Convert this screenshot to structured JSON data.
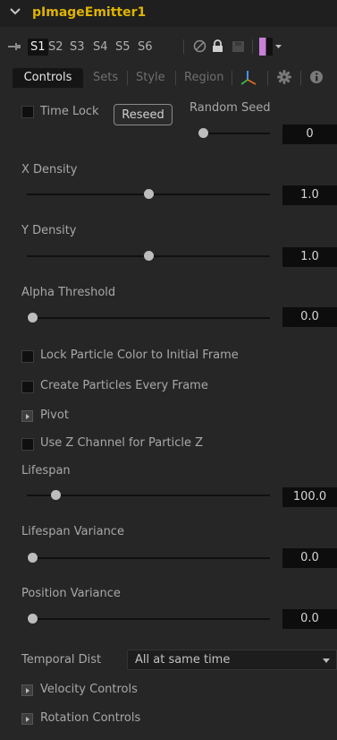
{
  "tool": {
    "name": "pImageEmitter1"
  },
  "slots": [
    "S1",
    "S2",
    "S3",
    "S4",
    "S5",
    "S6"
  ],
  "tabs": {
    "controls": "Controls",
    "sets": "Sets",
    "style": "Style",
    "region": "Region"
  },
  "icons": [
    "pin-icon",
    "chevron-down-icon",
    "disable-icon",
    "lock-icon",
    "save-icon",
    "color-swatch-icon",
    "axis-icon",
    "gear-icon",
    "info-icon",
    "expander-arrow-icon"
  ],
  "colors": {
    "title": "#e0b400",
    "background": "#262626",
    "value_box": "#0d0d0d",
    "swatch_pink": "#c87fd6"
  },
  "controls": {
    "time_lock": {
      "label": "Time Lock",
      "checked": false
    },
    "reseed_label": "Reseed",
    "random_seed": {
      "label": "Random Seed",
      "value": "0",
      "fraction": 0.05
    },
    "x_density": {
      "label": "X Density",
      "value": "1.0",
      "fraction": 0.5
    },
    "y_density": {
      "label": "Y Density",
      "value": "1.0",
      "fraction": 0.5
    },
    "alpha_threshold": {
      "label": "Alpha Threshold",
      "value": "0.0",
      "fraction": 0.0
    },
    "lock_particle_color": {
      "label": "Lock Particle Color to Initial Frame",
      "checked": false
    },
    "create_particles": {
      "label": "Create Particles Every Frame",
      "checked": false
    },
    "pivot": {
      "label": "Pivot"
    },
    "use_z_channel": {
      "label": "Use Z Channel for Particle Z",
      "checked": false
    },
    "lifespan": {
      "label": "Lifespan",
      "value": "100.0",
      "fraction": 0.1
    },
    "lifespan_variance": {
      "label": "Lifespan Variance",
      "value": "0.0",
      "fraction": 0.0
    },
    "position_variance": {
      "label": "Position Variance",
      "value": "0.0",
      "fraction": 0.0
    },
    "temporal_dist": {
      "label": "Temporal Dist",
      "value": "All at same time"
    },
    "velocity_controls": {
      "label": "Velocity Controls"
    },
    "rotation_controls": {
      "label": "Rotation Controls"
    }
  }
}
